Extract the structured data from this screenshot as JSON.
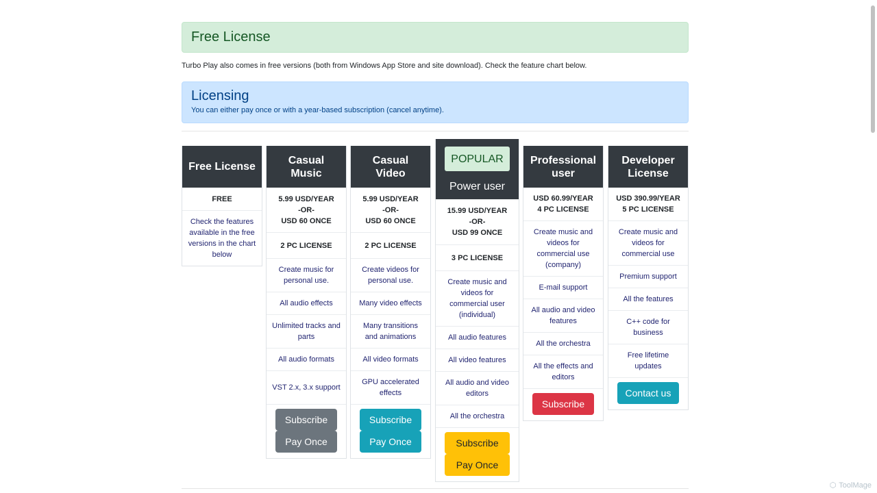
{
  "free_section": {
    "title": "Free License",
    "description": "Turbo Play also comes in free versions (both from Windows App Store and site download). Check the feature chart below."
  },
  "licensing": {
    "title": "Licensing",
    "subtitle": "You can either pay once or with a year-based subscription (cancel anytime)."
  },
  "plans": {
    "free": {
      "title": "Free License",
      "price": "FREE",
      "features": [
        "Check the features available in the free versions in the chart below"
      ]
    },
    "music": {
      "title": "Casual Music",
      "price_year": "5.99 USD/YEAR",
      "price_or": "-OR-",
      "price_once": "USD 60 ONCE",
      "license": "2 PC LICENSE",
      "features": [
        "Create music for personal use.",
        "All audio effects",
        "Unlimited tracks and parts",
        "All audio formats",
        "VST 2.x, 3.x support"
      ],
      "subscribe": "Subscribe",
      "pay_once": "Pay Once"
    },
    "video": {
      "title": "Casual Video",
      "price_year": "5.99 USD/YEAR",
      "price_or": "-OR-",
      "price_once": "USD 60 ONCE",
      "license": "2 PC LICENSE",
      "features": [
        "Create videos for personal use.",
        "Many video effects",
        "Many transitions and animations",
        "All video formats",
        "GPU accelerated effects"
      ],
      "subscribe": "Subscribe",
      "pay_once": "Pay Once"
    },
    "power": {
      "badge": "POPULAR",
      "title": "Power user",
      "price_year": "15.99 USD/YEAR",
      "price_or": "-OR-",
      "price_once": "USD 99 ONCE",
      "license": "3 PC LICENSE",
      "features": [
        "Create music and videos for commercial user (individual)",
        "All audio features",
        "All video features",
        "All audio and video editors",
        "All the orchestra"
      ],
      "subscribe": "Subscribe",
      "pay_once": "Pay Once"
    },
    "professional": {
      "title": "Professional user",
      "price_year": "USD 60.99/YEAR",
      "license": "4 PC LICENSE",
      "features": [
        "Create music and videos for commercial use (company)",
        "E-mail support",
        "All audio and video features",
        "All the orchestra",
        "All the effects and editors"
      ],
      "subscribe": "Subscribe"
    },
    "developer": {
      "title": "Developer License",
      "price_year": "USD 390.99/YEAR",
      "license": "5 PC LICENSE",
      "features": [
        "Create music and videos for commercial use",
        "Premium support",
        "All the features",
        "C++ code for business",
        "Free lifetime updates"
      ],
      "contact": "Contact us"
    }
  },
  "watermark": "ToolMage",
  "colors": {
    "header_dark": "#343a40",
    "success_bg": "#d4edda",
    "info_bg": "#cce5ff",
    "gray_button": "#6c757d",
    "teal_button": "#17a2b8",
    "red_button": "#dc3545",
    "yellow_button": "#ffc107"
  }
}
